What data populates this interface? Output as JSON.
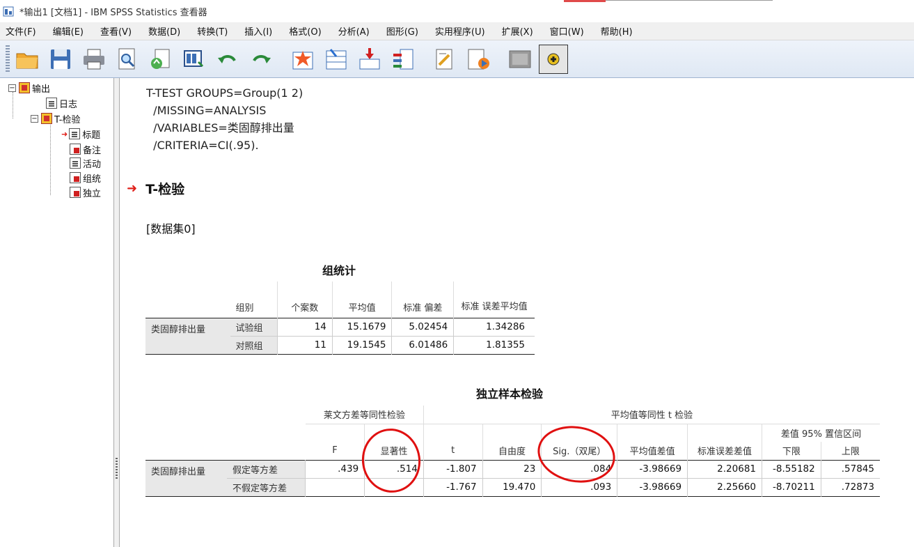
{
  "window": {
    "title": "*输出1 [文档1] - IBM SPSS Statistics 查看器"
  },
  "menu": [
    "文件(F)",
    "编辑(E)",
    "查看(V)",
    "数据(D)",
    "转换(T)",
    "插入(I)",
    "格式(O)",
    "分析(A)",
    "图形(G)",
    "实用程序(U)",
    "扩展(X)",
    "窗口(W)",
    "帮助(H)"
  ],
  "toolbar": {
    "icons": [
      "open-folder-icon",
      "save-icon",
      "print-icon",
      "print-preview-icon",
      "export-icon",
      "recall-dialog-icon",
      "undo-icon",
      "redo-icon",
      "goto-data-icon",
      "goto-case-icon",
      "goto-variable-icon",
      "variables-icon",
      "insert-title-icon",
      "insert-text-icon",
      "designated-window-icon",
      "add-icon"
    ]
  },
  "outline": {
    "root": "输出",
    "log": "日志",
    "ttest": "T-检验",
    "children": [
      "标题",
      "备注",
      "活动",
      "组统",
      "独立"
    ]
  },
  "syntax": [
    "T-TEST GROUPS=Group(1 2)",
    "  /MISSING=ANALYSIS",
    "  /VARIABLES=类固醇排出量",
    "  /CRITERIA=CI(.95)."
  ],
  "heading": "T-检验",
  "dataset": "[数据集0]",
  "group_stats": {
    "title": "组统计",
    "headers": [
      "组别",
      "个案数",
      "平均值",
      "标准 偏差",
      "标准 误差平均值"
    ],
    "variable": "类固醇排出量",
    "rows": [
      {
        "group": "试验组",
        "n": "14",
        "mean": "15.1679",
        "sd": "5.02454",
        "se": "1.34286"
      },
      {
        "group": "对照组",
        "n": "11",
        "mean": "19.1545",
        "sd": "6.01486",
        "se": "1.81355"
      }
    ]
  },
  "ind_test": {
    "title": "独立样本检验",
    "levene_header": "莱文方差等同性检验",
    "ttest_header": "平均值等同性 t 检验",
    "ci_header": "差值 95% 置信区间",
    "headers": [
      "F",
      "显著性",
      "t",
      "自由度",
      "Sig.（双尾）",
      "平均值差值",
      "标准误差差值",
      "下限",
      "上限"
    ],
    "variable": "类固醇排出量",
    "rows": [
      {
        "label": "假定等方差",
        "F": ".439",
        "sig": ".514",
        "t": "-1.807",
        "df": "23",
        "sig2": ".084",
        "md": "-3.98669",
        "sed": "2.20681",
        "lo": "-8.55182",
        "hi": ".57845"
      },
      {
        "label": "不假定等方差",
        "F": "",
        "sig": "",
        "t": "-1.767",
        "df": "19.470",
        "sig2": ".093",
        "md": "-3.98669",
        "sed": "2.25660",
        "lo": "-8.70211",
        "hi": ".72873"
      }
    ]
  },
  "colors": {
    "annotation": "#e01010",
    "heading_arrow": "#e0201a",
    "row_label_bg": "#e8e8e8"
  }
}
